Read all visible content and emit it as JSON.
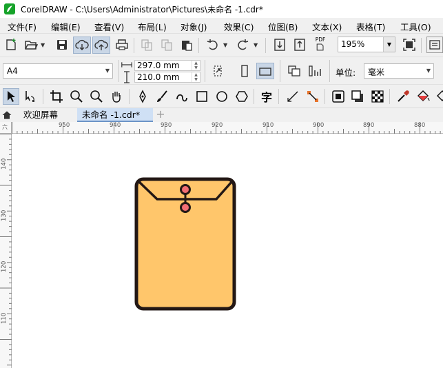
{
  "window": {
    "title": "CorelDRAW - C:\\Users\\Administrator\\Pictures\\未命名 -1.cdr*"
  },
  "menu": [
    {
      "label": "文件(F)"
    },
    {
      "label": "编辑(E)"
    },
    {
      "label": "查看(V)"
    },
    {
      "label": "布局(L)"
    },
    {
      "label": "对象(J)"
    },
    {
      "label": "效果(C)"
    },
    {
      "label": "位图(B)"
    },
    {
      "label": "文本(X)"
    },
    {
      "label": "表格(T)"
    },
    {
      "label": "工具(O)"
    }
  ],
  "toolbar": {
    "zoom": "195%",
    "pdf_label": "PDF"
  },
  "property_bar": {
    "page_size": "A4",
    "width": "297.0 mm",
    "height": "210.0 mm",
    "unit_label": "单位:",
    "unit_value": "毫米"
  },
  "tools": {
    "text_tool_glyph": "字"
  },
  "tabs": [
    {
      "label": "欢迎屏幕"
    },
    {
      "label": "未命名 -1.cdr*"
    }
  ],
  "ruler": {
    "horizontal": [
      "950",
      "940",
      "930",
      "920",
      "910",
      "900",
      "890",
      "880"
    ],
    "vertical": [
      "140",
      "130",
      "120",
      "110"
    ],
    "unit_glyph": "六"
  },
  "drawing": {
    "envelope_fill": "#FFC66B",
    "outline": "#231815",
    "button_fill": "#F26E74"
  }
}
